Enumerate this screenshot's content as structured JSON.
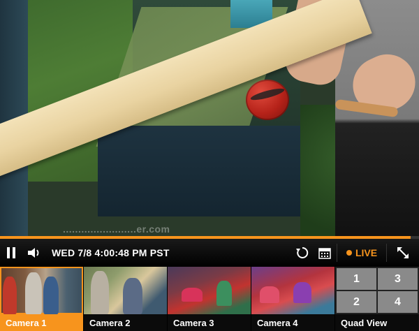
{
  "player": {
    "watermark": "........................er.com",
    "progress_fraction": 0.98,
    "timestamp": "WED 7/8 4:00:48 PM PST",
    "live_label": "LIVE",
    "icons": {
      "pause": "pause-icon",
      "volume": "volume-icon",
      "rewind": "rewind-icon",
      "calendar": "calendar-icon",
      "expand": "expand-icon"
    },
    "accent_color": "#f7941d"
  },
  "cameras": [
    {
      "label": "Camera 1",
      "active": true
    },
    {
      "label": "Camera 2",
      "active": false
    },
    {
      "label": "Camera 3",
      "active": false
    },
    {
      "label": "Camera 4",
      "active": false
    }
  ],
  "quad_view": {
    "label": "Quad View",
    "cells": [
      "1",
      "3",
      "2",
      "4"
    ]
  }
}
